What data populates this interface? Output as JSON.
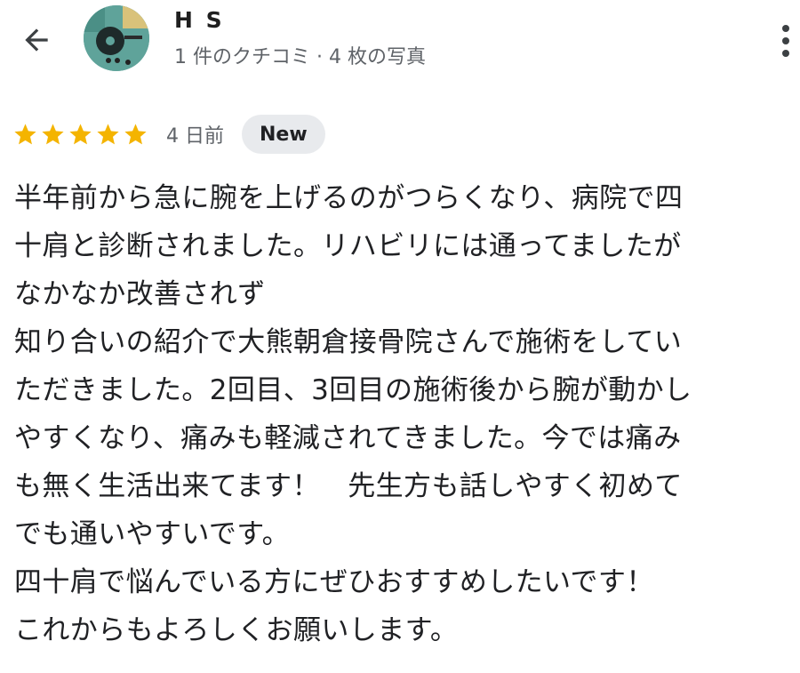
{
  "header": {
    "user_name": "H S",
    "user_meta": "1 件のクチコミ · 4 枚の写真"
  },
  "review": {
    "star_count": 5,
    "rating": 5,
    "date": "4 日前",
    "badge": "New",
    "lines": [
      "半年前から急に腕を上げるのがつらくなり、病院で四",
      "十肩と診断されました。リハビリには通ってましたが",
      "なかなか改善されず",
      "知り合いの紹介で大熊朝倉接骨院さんで施術をしてい",
      "ただきました。2回目、3回目の施術後から腕が動かし",
      "やすくなり、痛みも軽減されてきました。今では痛み",
      "も無く生活出来てます！　先生方も話しやすく初めて",
      "でも通いやすいです。",
      "四十肩で悩んでいる方にぜひおすすめしたいです！",
      "これからもよろしくお願いします。"
    ]
  },
  "colors": {
    "star": "#f4b400",
    "badge_bg": "#e8eaed",
    "meta_text": "#5f6368",
    "avatar_bg": "#5fa39a"
  },
  "icons": {
    "back": "arrow-left-icon",
    "more": "more-vert-icon",
    "star": "star-icon"
  }
}
